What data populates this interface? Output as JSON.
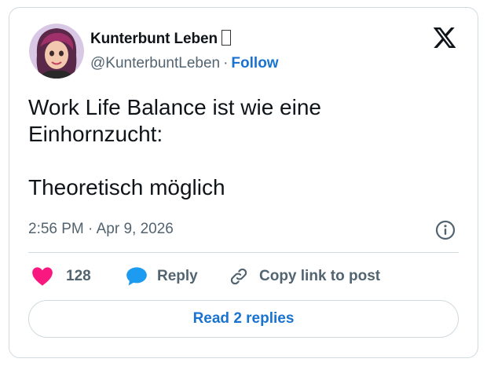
{
  "author": {
    "display_name": "Kunterbunt Leben",
    "handle": "@KunterbuntLeben",
    "separator": "·",
    "follow_label": "Follow"
  },
  "tweet": {
    "text": "Work Life Balance ist wie eine\nEinhornzucht:\n\nTheoretisch möglich",
    "timestamp": "2:56 PM · Apr 9, 2026"
  },
  "actions": {
    "like_count": "128",
    "reply_label": "Reply",
    "copy_link_label": "Copy link to post"
  },
  "footer": {
    "read_replies_label": "Read 2 replies"
  },
  "colors": {
    "accent": "#1a73d0",
    "like": "#f91880",
    "reply": "#1d9bf0",
    "muted": "#536471"
  },
  "icons": {
    "logo": "x-logo-icon",
    "info": "info-icon",
    "like": "heart-icon",
    "reply": "speech-bubble-icon",
    "copy": "link-icon"
  }
}
